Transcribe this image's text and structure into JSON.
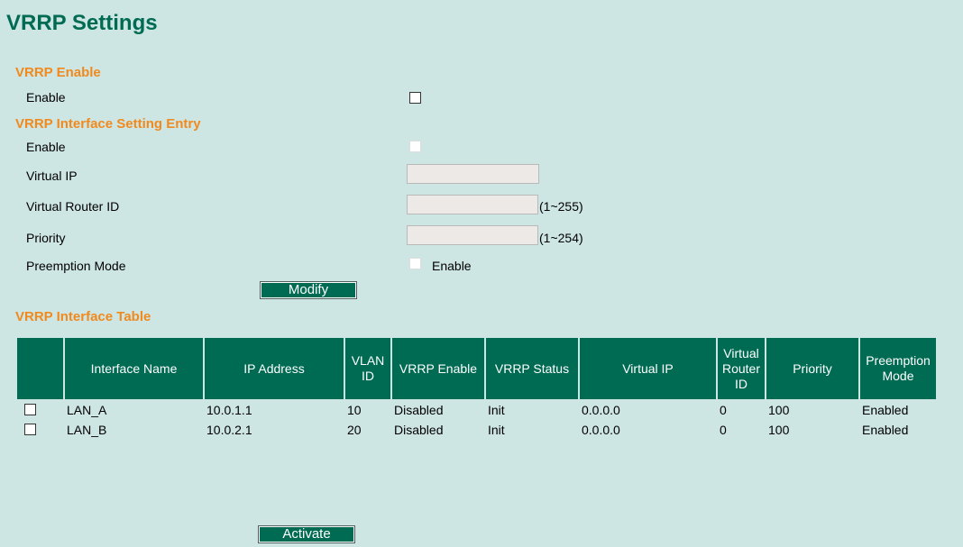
{
  "page": {
    "title": "VRRP Settings"
  },
  "vrrp_enable": {
    "heading": "VRRP Enable",
    "enable_label": "Enable",
    "enabled": false
  },
  "entry": {
    "heading": "VRRP Interface Setting Entry",
    "enable_label": "Enable",
    "virtual_ip_label": "Virtual IP",
    "virtual_ip_value": "",
    "router_id_label": "Virtual Router ID",
    "router_id_value": "",
    "router_id_hint": "(1~255)",
    "priority_label": "Priority",
    "priority_value": "",
    "priority_hint": "(1~254)",
    "preemption_label": "Preemption Mode",
    "preemption_option": "Enable",
    "modify_label": "Modify"
  },
  "table": {
    "heading": "VRRP Interface Table",
    "columns": [
      "",
      "Interface Name",
      "IP Address",
      "VLAN ID",
      "VRRP Enable",
      "VRRP Status",
      "Virtual IP",
      "Virtual Router ID",
      "Priority",
      "Preemption Mode"
    ],
    "rows": [
      [
        "LAN_A",
        "10.0.1.1",
        "10",
        "Disabled",
        "Init",
        "0.0.0.0",
        "0",
        "100",
        "Enabled"
      ],
      [
        "LAN_B",
        "10.0.2.1",
        "20",
        "Disabled",
        "Init",
        "0.0.0.0",
        "0",
        "100",
        "Enabled"
      ]
    ]
  },
  "activate_label": "Activate",
  "colors": {
    "header_green": "#006b53",
    "section_orange": "#f18a1e",
    "background": "#cde5e3"
  }
}
